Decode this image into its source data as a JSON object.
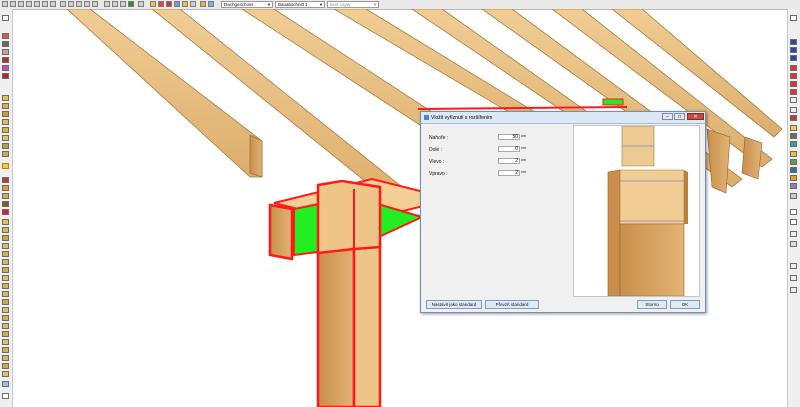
{
  "toolbar": {
    "floor_combo": "Dachgeschoss",
    "section_combo": "Bauabschnitt 1",
    "layer_combo": "kein Layer"
  },
  "dialog": {
    "title": "Vložit vyříznutí s rozšířením",
    "fields": [
      {
        "label": "Nahoře :",
        "value": "50",
        "unit": "cm"
      },
      {
        "label": "Dole :",
        "value": "0",
        "unit": "cm"
      },
      {
        "label": "Vlevo :",
        "value": "2",
        "unit": "cm"
      },
      {
        "label": "Vpravo :",
        "value": "2",
        "unit": "cm"
      }
    ],
    "buttons": {
      "set_default": "Nastavit jako standard",
      "load_default": "Převzít standard",
      "cancel": "Storno",
      "ok": "OK"
    }
  },
  "colors": {
    "wood": "#e4b77a",
    "wood_dark": "#b98545",
    "cut_green": "#22ee22",
    "cut_yellow": "#ffee00",
    "cut_red": "#ff1a1a",
    "titlebar": "#dce8f5"
  },
  "icons": {
    "close": "close-icon",
    "maximize": "maximize-icon",
    "minimize": "minimize-icon"
  }
}
